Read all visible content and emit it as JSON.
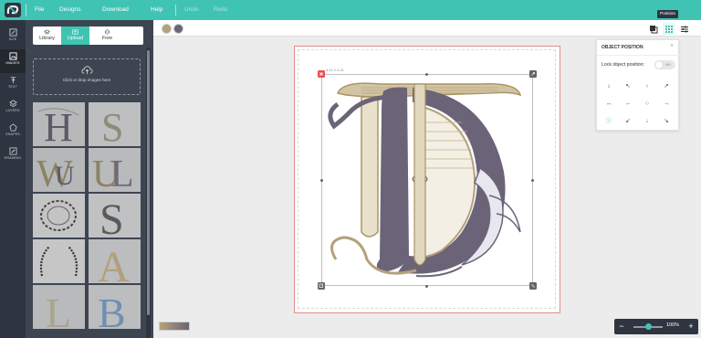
{
  "app": {
    "logo": "logo-icon",
    "menu": [
      "File",
      "Designs",
      "Download",
      "Help"
    ],
    "undo": "Undo",
    "redo": "Redo"
  },
  "sidebar": {
    "items": [
      {
        "label": "SIZE",
        "icon": "size-icon"
      },
      {
        "label": "IMAGES",
        "icon": "image-icon",
        "active": true
      },
      {
        "label": "TEXT",
        "icon": "text-icon"
      },
      {
        "label": "LAYERS",
        "icon": "layers-icon"
      },
      {
        "label": "SHAPES",
        "icon": "shapes-icon"
      },
      {
        "label": "DRAWING",
        "icon": "drawing-icon"
      }
    ]
  },
  "panel": {
    "tabs": [
      {
        "label": "Library",
        "icon": "library-icon"
      },
      {
        "label": "Upload",
        "icon": "upload-icon",
        "active": true
      },
      {
        "label": "Free",
        "icon": "free-icon"
      }
    ],
    "dropzone_text": "Click or drop images here",
    "thumbnails": [
      "H",
      "S",
      "W",
      "UL",
      "wreath",
      "S",
      "wreath",
      "A",
      "L",
      "B"
    ]
  },
  "toolbar": {
    "swatches": [
      "#b5a07a",
      "#6b6478"
    ],
    "tooltip": "Position",
    "icons": [
      "arrange-icon",
      "position-icon",
      "adjust-icon"
    ]
  },
  "canvas": {
    "size_label": "4.21 x 4.21",
    "monogram": "TD monogram",
    "colors": {
      "gold": "#b5a07a",
      "purple": "#6b6478",
      "red": "#e55353"
    }
  },
  "position_popup": {
    "title": "OBJECT POSITION",
    "lock_label": "Lock object position:",
    "toggle_label": "NO",
    "close": "×",
    "buttons": [
      "↕",
      "↖",
      "↑",
      "↗",
      "↔",
      "←",
      "○",
      "→",
      "ⓘ",
      "↙",
      "↓",
      "↘"
    ]
  },
  "zoom": {
    "minus": "−",
    "plus": "+",
    "percent": "100%",
    "level": 0.5
  }
}
